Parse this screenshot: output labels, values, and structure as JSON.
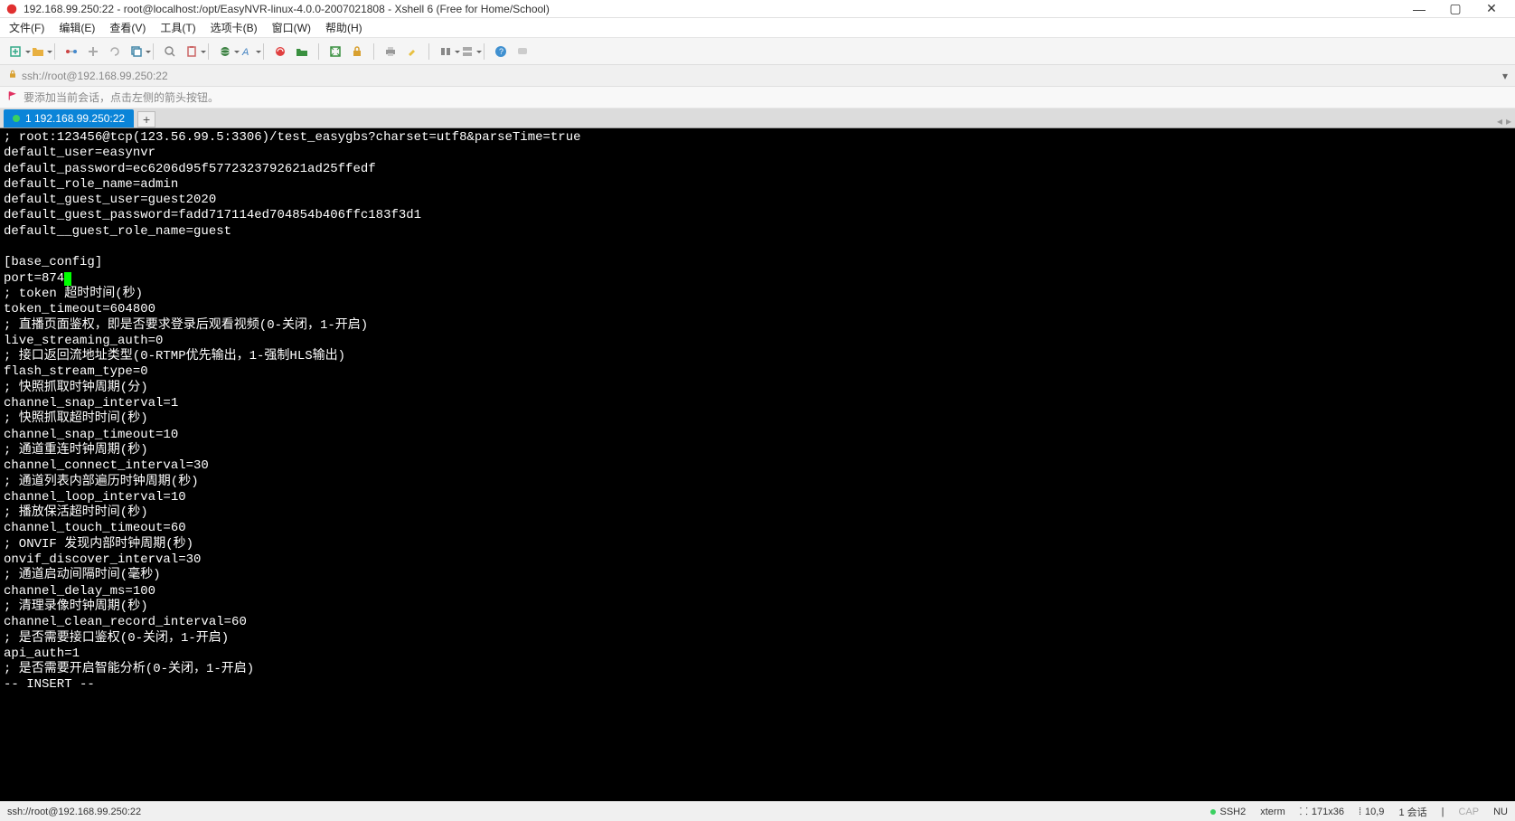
{
  "window": {
    "title": "192.168.99.250:22 - root@localhost:/opt/EasyNVR-linux-4.0.0-2007021808 - Xshell 6 (Free for Home/School)"
  },
  "menu": {
    "file": "文件(F)",
    "edit": "编辑(E)",
    "view": "查看(V)",
    "tools": "工具(T)",
    "tabs": "选项卡(B)",
    "window": "窗口(W)",
    "help": "帮助(H)"
  },
  "address": {
    "text": "ssh://root@192.168.99.250:22"
  },
  "hint": {
    "text": "要添加当前会话，点击左侧的箭头按钮。"
  },
  "tab": {
    "label": "1 192.168.99.250:22"
  },
  "terminal": {
    "lines": [
      "; root:123456@tcp(123.56.99.5:3306)/test_easygbs?charset=utf8&parseTime=true",
      "default_user=easynvr",
      "default_password=ec6206d95f5772323792621ad25ffedf",
      "default_role_name=admin",
      "default_guest_user=guest2020",
      "default_guest_password=fadd717114ed704854b406ffc183f3d1",
      "default__guest_role_name=guest",
      "",
      "[base_config]",
      "port=874",
      "; token 超时时间(秒)",
      "token_timeout=604800",
      "; 直播页面鉴权，即是否要求登录后观看视频(0-关闭，1-开启)",
      "live_streaming_auth=0",
      "; 接口返回流地址类型(0-RTMP优先输出，1-强制HLS输出)",
      "flash_stream_type=0",
      "; 快照抓取时钟周期(分)",
      "channel_snap_interval=1",
      "; 快照抓取超时时间(秒)",
      "channel_snap_timeout=10",
      "; 通道重连时钟周期(秒)",
      "channel_connect_interval=30",
      "; 通道列表内部遍历时钟周期(秒)",
      "channel_loop_interval=10",
      "; 播放保活超时时间(秒)",
      "channel_touch_timeout=60",
      "; ONVIF 发现内部时钟周期(秒)",
      "onvif_discover_interval=30",
      "; 通道启动间隔时间(毫秒)",
      "channel_delay_ms=100",
      "; 清理录像时钟周期(秒)",
      "channel_clean_record_interval=60",
      "; 是否需要接口鉴权(0-关闭，1-开启)",
      "api_auth=1",
      "; 是否需要开启智能分析(0-关闭，1-开启)",
      "-- INSERT --"
    ],
    "cursor_line_index": 9
  },
  "status": {
    "path": "ssh://root@192.168.99.250:22",
    "proto": "SSH2",
    "term": "xterm",
    "size": "171x36",
    "pos": "10,9",
    "sessions": "1 会话",
    "cap": "CAP",
    "num": "NU"
  }
}
